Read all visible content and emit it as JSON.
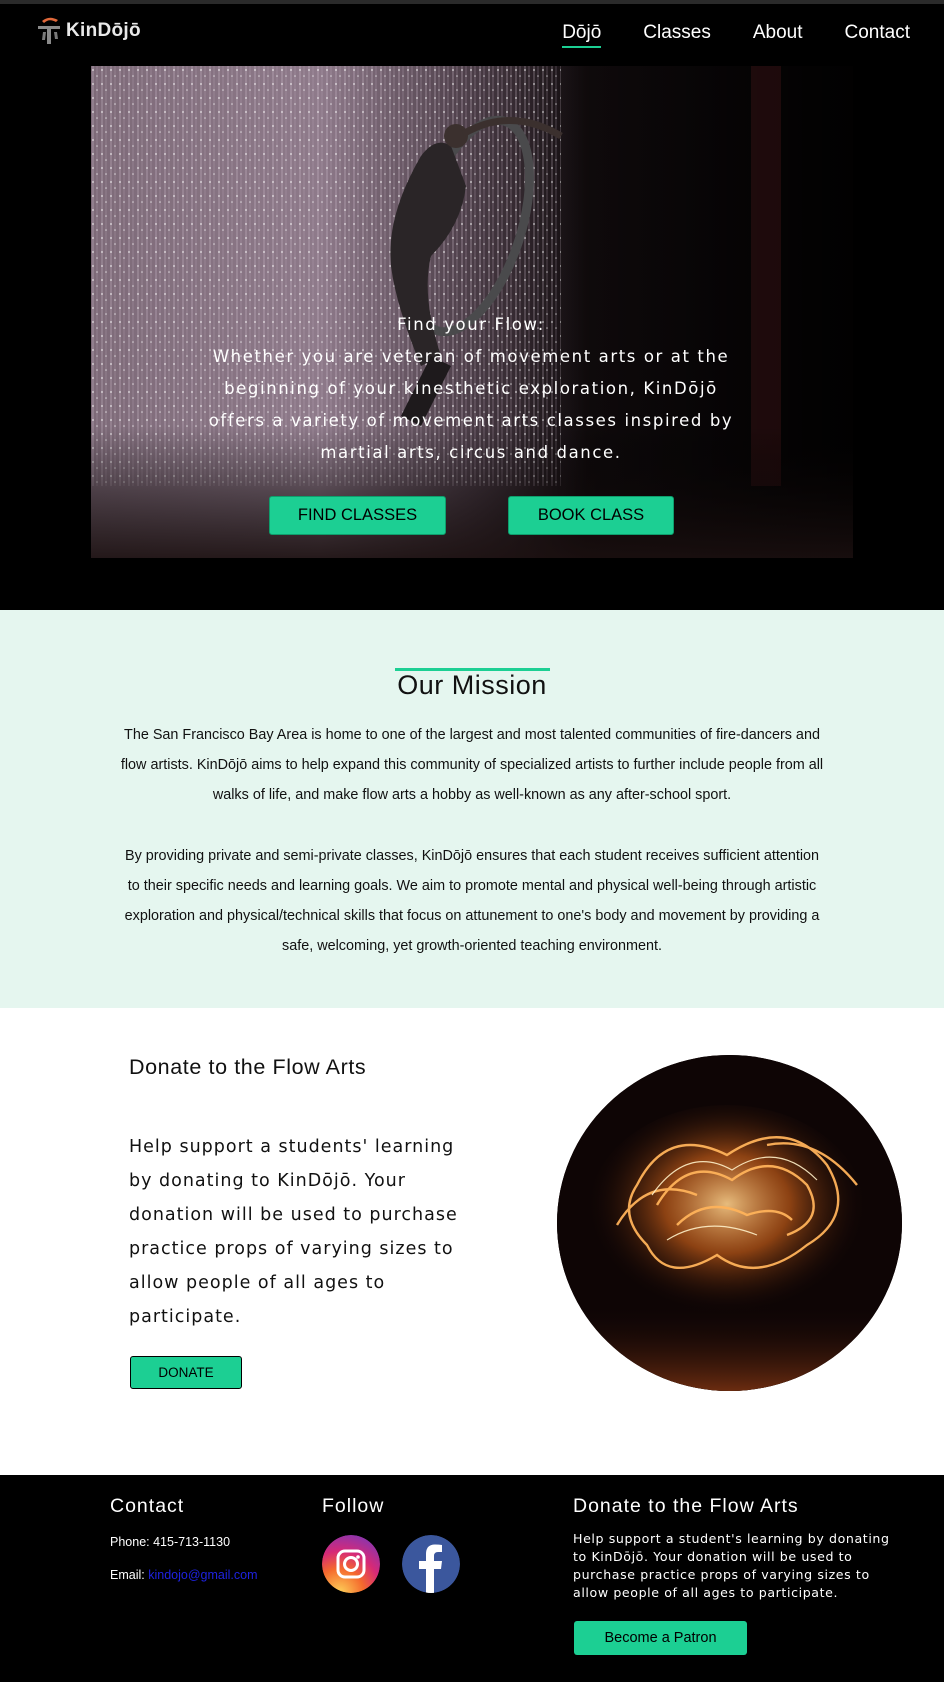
{
  "nav": {
    "brand": "KinDōjō",
    "links": [
      {
        "label": "Dōjō",
        "active": true
      },
      {
        "label": "Classes"
      },
      {
        "label": "About"
      },
      {
        "label": "Contact"
      }
    ]
  },
  "hero": {
    "heading": "Find your Flow:",
    "body": "Whether you are veteran of movement arts or at the beginning of your kinesthetic exploration, KinDōjō offers a variety of movement arts classes inspired by martial arts, circus and dance.",
    "buttons": {
      "find": "FIND CLASSES",
      "book": "BOOK CLASS"
    }
  },
  "mission": {
    "title": "Our Mission",
    "paragraphs": [
      "The San Francisco Bay Area is home to one of the largest and most talented communities of fire-dancers and flow artists. KinDōjō aims to help expand this community of specialized artists to further include people from all walks of life, and make flow arts a hobby as well-known as any after-school sport.",
      "By providing private and semi-private classes, KinDōjō ensures that each student receives sufficient attention to their specific needs and learning goals. We aim to promote mental and physical well-being through artistic exploration and physical/technical skills that focus on attunement to one's body and movement by providing a safe, welcoming, yet growth-oriented teaching environment."
    ]
  },
  "donate": {
    "title": "Donate to the Flow Arts",
    "text": "Help support a students' learning by donating to KinDōjō. Your donation will be used to purchase practice props of varying sizes to allow people of all ages to participate.",
    "button": "DONATE"
  },
  "footer": {
    "contact": {
      "title": "Contact",
      "phone_label": "Phone:",
      "phone": "415-713-1130",
      "email_label": "Email:",
      "email": "kindojo@gmail.com"
    },
    "follow": {
      "title": "Follow",
      "icons": [
        "instagram-icon",
        "facebook-icon"
      ]
    },
    "donate": {
      "title": "Donate to the Flow Arts",
      "text": "Help support a student's learning by donating to KinDōjō. Your donation will be used to purchase practice props of varying sizes to allow people of all ages to participate.",
      "button": "Become a Patron"
    }
  },
  "colors": {
    "accent": "#1ccf93",
    "nav_bg": "#000000",
    "mission_bg": "#e5f6ef",
    "link": "#1e22e0"
  }
}
